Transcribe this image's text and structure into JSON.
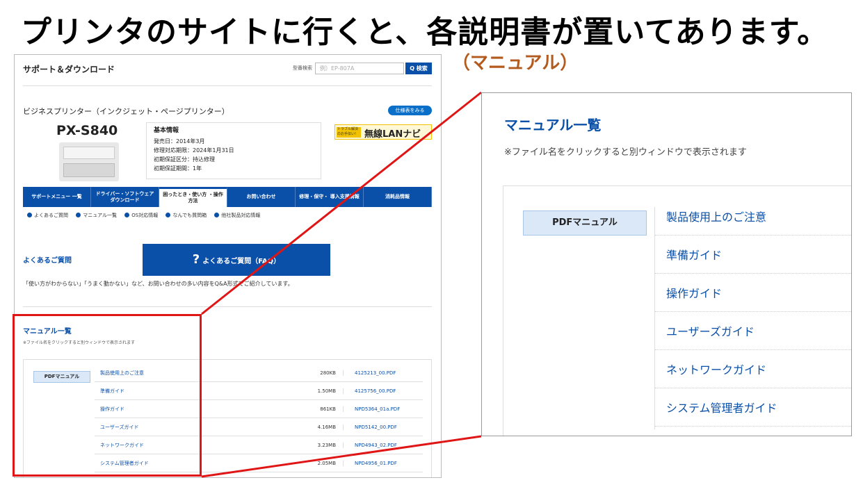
{
  "headline": "プリンタのサイトに行くと、各説明書が置いてあります。",
  "subheadline": "（マニュアル）",
  "page": {
    "site_title": "サポート＆ダウンロード",
    "model_search_label": "型番検索",
    "model_search_placeholder": "例）EP-807A",
    "search_button": "Q 検索",
    "category": "ビジネスプリンター（インクジェット・ページプリンター）",
    "spec_button": "仕様表をみる",
    "model_name": "PX-S840",
    "basic_info": {
      "title": "基本情報",
      "release": "発売日：2014年3月",
      "repair_deadline": "修理対応期限：2024年1月31日",
      "warranty_type": "初期保証区分：持込修理",
      "warranty_period": "初期保証期間：1年"
    },
    "wlan_banner": {
      "small": "トラブル解決 のお手伝い!",
      "big": "無線LANナビ"
    },
    "nav_tabs": [
      "サポートメニュー 一覧",
      "ドライバー・ソフトウェア ダウンロード",
      "困ったとき・使い方 ・操作方法",
      "お問い合わせ",
      "修理・保守・ 導入支援情報",
      "消耗品情報"
    ],
    "sub_links": [
      "よくあるご質問",
      "マニュアル一覧",
      "OS対応情報",
      "なんでも質問箱",
      "他社製品対応情報"
    ],
    "faq_heading": "よくあるご質問",
    "faq_button_mark": "?",
    "faq_button": "よくあるご質問（FAQ）",
    "faq_text": "「使い方がわからない」「うまく動かない」など、お問い合わせの多い内容をQ&A形式でご紹介しています。",
    "manual_heading": "マニュアル一覧",
    "manual_note": "※ファイル名をクリックすると別ウィンドウで表示されます",
    "pdf_label": "PDFマニュアル",
    "manuals": [
      {
        "name": "製品使用上のご注意",
        "size": "280KB",
        "file": "4125213_00.PDF"
      },
      {
        "name": "準備ガイド",
        "size": "1.50MB",
        "file": "4125756_00.PDF"
      },
      {
        "name": "操作ガイド",
        "size": "861KB",
        "file": "NPD5364_01a.PDF"
      },
      {
        "name": "ユーザーズガイド",
        "size": "4.16MB",
        "file": "NPD5142_00.PDF"
      },
      {
        "name": "ネットワークガイド",
        "size": "3.23MB",
        "file": "NPD4943_02.PDF"
      },
      {
        "name": "システム管理者ガイド",
        "size": "2.05MB",
        "file": "NPD4956_01.PDF"
      }
    ]
  },
  "zoom": {
    "heading": "マニュアル一覧",
    "note": "※ファイル名をクリックすると別ウィンドウで表示されます",
    "pdf_label": "PDFマニュアル",
    "items": [
      "製品使用上のご注意",
      "準備ガイド",
      "操作ガイド",
      "ユーザーズガイド",
      "ネットワークガイド",
      "システム管理者ガイド"
    ]
  },
  "colors": {
    "accent": "#0a4fa8",
    "highlight": "#e01515",
    "subheadline": "#b35a1f"
  }
}
